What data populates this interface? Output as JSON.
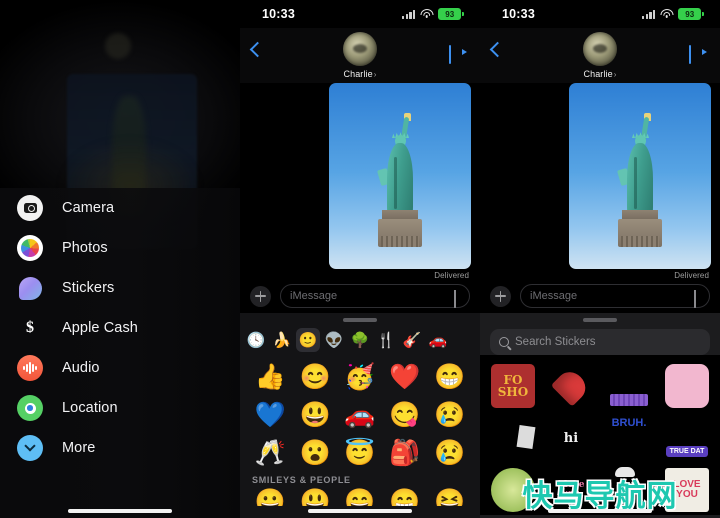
{
  "status_bar": {
    "time": "10:33",
    "battery_level": "93",
    "battery_color": "#35d04b",
    "signal_icon": "cellular-signal-icon",
    "wifi_icon": "wifi-icon",
    "battery_icon": "battery-icon"
  },
  "nav": {
    "contact_name": "Charlie",
    "back_icon": "back-chevron-icon",
    "video_icon": "video-call-icon",
    "avatar_icon": "contact-avatar",
    "disclosure": "›"
  },
  "chat": {
    "delivered_label": "Delivered",
    "photo_alt": "statue-of-liberty-photo"
  },
  "input_bar": {
    "plus_icon": "plus-apps-button",
    "placeholder": "iMessage",
    "mic_icon": "mic-icon"
  },
  "app_drawer": {
    "items": [
      {
        "label": "Camera",
        "icon": "camera-icon",
        "name": "camera"
      },
      {
        "label": "Photos",
        "icon": "photos-icon",
        "name": "photos"
      },
      {
        "label": "Stickers",
        "icon": "stickers-icon",
        "name": "stickers"
      },
      {
        "label": "Apple Cash",
        "icon": "apple-cash-icon",
        "name": "apple-cash"
      },
      {
        "label": "Audio",
        "icon": "audio-icon",
        "name": "audio"
      },
      {
        "label": "Location",
        "icon": "location-icon",
        "name": "location"
      },
      {
        "label": "More",
        "icon": "chevron-down-icon",
        "name": "more"
      }
    ]
  },
  "emoji_keyboard": {
    "grabber": "drag-handle",
    "tabs": [
      {
        "glyph": "🕓",
        "name": "recents-tab",
        "selected": false
      },
      {
        "glyph": "🍌",
        "name": "food-tab",
        "selected": false
      },
      {
        "glyph": "🙂",
        "name": "smileys-tab",
        "selected": true
      },
      {
        "glyph": "👽",
        "name": "creatures-tab",
        "selected": false
      },
      {
        "glyph": "🌳",
        "name": "nature-tab",
        "selected": false
      },
      {
        "glyph": "🍴",
        "name": "utensils-tab",
        "selected": false
      },
      {
        "glyph": "🎸",
        "name": "activity-tab",
        "selected": false
      },
      {
        "glyph": "🚗",
        "name": "travel-tab",
        "selected": false
      }
    ],
    "grid": [
      {
        "glyph": "👍",
        "name": "thumbs-up-emoji"
      },
      {
        "glyph": "😊",
        "name": "smiling-face-emoji"
      },
      {
        "glyph": "🥳",
        "name": "partying-face-emoji"
      },
      {
        "glyph": "❤️",
        "name": "red-heart-emoji"
      },
      {
        "glyph": "😁",
        "name": "beaming-face-emoji"
      },
      {
        "glyph": "💙",
        "name": "blue-heart-emoji"
      },
      {
        "glyph": "😃",
        "name": "grinning-face-emoji"
      },
      {
        "glyph": "🚗",
        "name": "car-emoji"
      },
      {
        "glyph": "😋",
        "name": "savoring-food-emoji"
      },
      {
        "glyph": "😢",
        "name": "crying-face-emoji"
      },
      {
        "glyph": "🥂",
        "name": "clinking-glasses-emoji"
      },
      {
        "glyph": "😮",
        "name": "face-with-open-mouth-emoji"
      },
      {
        "glyph": "😇",
        "name": "halo-face-emoji"
      },
      {
        "glyph": "🎒",
        "name": "backpack-emoji"
      },
      {
        "glyph": "😢",
        "name": "crying-face-emoji-2"
      }
    ],
    "section_title": "SMILEYS & PEOPLE",
    "next_row": [
      {
        "glyph": "😀",
        "name": "grinning-emoji-partial-1"
      },
      {
        "glyph": "😃",
        "name": "grinning-emoji-partial-2"
      },
      {
        "glyph": "😄",
        "name": "grinning-emoji-partial-3"
      },
      {
        "glyph": "😁",
        "name": "grinning-emoji-partial-4"
      },
      {
        "glyph": "😆",
        "name": "grinning-emoji-partial-5"
      }
    ]
  },
  "sticker_browser": {
    "grabber": "drag-handle",
    "search_placeholder": "Search Stickers",
    "search_icon": "search-icon",
    "stickers": [
      {
        "label": "FO SHO",
        "name": "sticker-fo-sho",
        "kind": "text",
        "color": "#f0b63c",
        "bg": "#b03030"
      },
      {
        "label": "",
        "name": "sticker-heart-guy",
        "kind": "heart",
        "color": "#d93a3a",
        "bg": "#000000"
      },
      {
        "label": "",
        "name": "sticker-guy-purple",
        "kind": "guy",
        "color": "#8a5fd0",
        "bg": "#000000"
      },
      {
        "label": "",
        "name": "sticker-love-bubble",
        "kind": "bubble",
        "color": "#f2b7cf",
        "bg": "#000000"
      },
      {
        "label": "",
        "name": "sticker-guy-reading",
        "kind": "guy",
        "color": "#cfcfcf",
        "bg": "#000000"
      },
      {
        "label": "hi",
        "name": "sticker-hi",
        "kind": "text",
        "color": "#f2f2f2",
        "bg": "#000000"
      },
      {
        "label": "BRUH.",
        "name": "sticker-bruh",
        "kind": "text",
        "color": "#2f4fd0",
        "bg": "#000000"
      },
      {
        "label": "TRUE DAT",
        "name": "sticker-true-dat",
        "kind": "text",
        "color": "#ffffff",
        "bg": "#5a3fc0"
      },
      {
        "label": "",
        "name": "sticker-laptop-guy",
        "kind": "guy",
        "color": "#6ab04c",
        "bg": "#000000"
      },
      {
        "label": "i love you",
        "name": "sticker-i-love-you",
        "kind": "text",
        "color": "#e87aa8",
        "bg": "#000000"
      },
      {
        "label": "",
        "name": "sticker-chef-guy",
        "kind": "guy",
        "color": "#dddddd",
        "bg": "#000000"
      },
      {
        "label": "LOVE YOU",
        "name": "sticker-love-you",
        "kind": "text",
        "color": "#d93a5a",
        "bg": "#000000"
      }
    ]
  },
  "watermark": {
    "text": "快马导航网",
    "color": "#1ec8b0"
  },
  "home_indicator": "home-indicator"
}
